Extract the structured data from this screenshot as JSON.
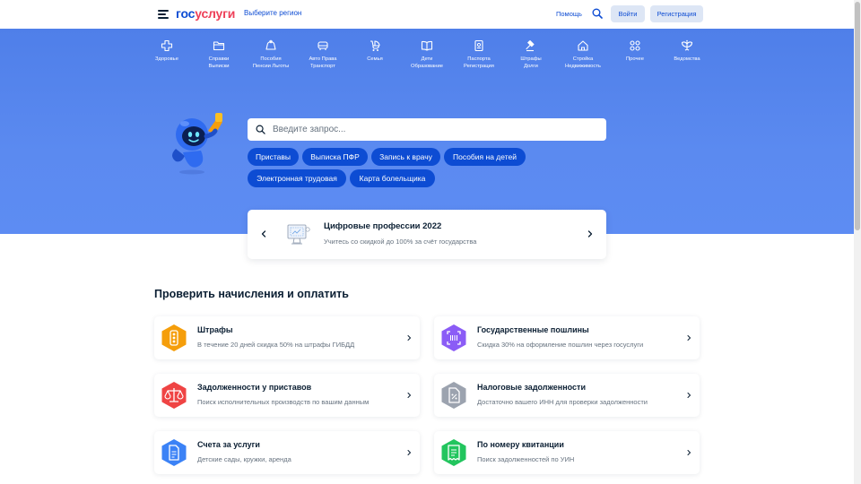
{
  "header": {
    "logo_part1": "гос",
    "logo_part2": "услуги",
    "region_link": "Выберите регион",
    "help_link": "Помощь",
    "login_button": "Войти",
    "register_button": "Регистрация"
  },
  "categories": [
    {
      "line1": "Здоровье",
      "line2": "",
      "icon": "health-cross-icon"
    },
    {
      "line1": "Справки",
      "line2": "Выписки",
      "icon": "folder-icon"
    },
    {
      "line1": "Пособия",
      "line2": "Пенсии Льготы",
      "icon": "piggy-bank-icon"
    },
    {
      "line1": "Авто Права",
      "line2": "Транспорт",
      "icon": "car-icon"
    },
    {
      "line1": "Семья",
      "line2": "",
      "icon": "stroller-icon"
    },
    {
      "line1": "Дети",
      "line2": "Образование",
      "icon": "book-icon"
    },
    {
      "line1": "Паспорта",
      "line2": "Регистрация",
      "icon": "passport-icon"
    },
    {
      "line1": "Штрафы",
      "line2": "Долги",
      "icon": "gavel-icon"
    },
    {
      "line1": "Стройка",
      "line2": "Недвижимость",
      "icon": "house-icon"
    },
    {
      "line1": "Прочее",
      "line2": "",
      "icon": "grid-icon"
    },
    {
      "line1": "Ведомства",
      "line2": "",
      "icon": "emblem-icon"
    }
  ],
  "search": {
    "placeholder": "Введите запрос..."
  },
  "chips": [
    "Приставы",
    "Выписка ПФР",
    "Запись к врачу",
    "Пособия на детей",
    "Электронная трудовая",
    "Карта болельщика"
  ],
  "promo": {
    "title": "Цифровые профессии 2022",
    "subtitle": "Учитесь со скидкой до 100% за счёт государства"
  },
  "section": {
    "title": "Проверить начисления и оплатить",
    "cards": [
      {
        "title": "Штрафы",
        "subtitle": "В течение 20 дней скидка 50% на штрафы ГИБДД",
        "color": "#f59e0b",
        "icon": "traffic-light-icon"
      },
      {
        "title": "Государственные пошлины",
        "subtitle": "Скидка 30% на оформление пошлин через госуслуги",
        "color": "#8b5cf6",
        "icon": "scan-icon"
      },
      {
        "title": "Задолженности у приставов",
        "subtitle": "Поиск исполнительных производств по вашим данным",
        "color": "#ef4444",
        "icon": "scales-icon"
      },
      {
        "title": "Налоговые задолженности",
        "subtitle": "Достаточно вашего ИНН для проверки задолженности",
        "color": "#9ca3af",
        "icon": "document-percent-icon"
      },
      {
        "title": "Счета за услуги",
        "subtitle": "Детские сады, кружки, аренда",
        "color": "#3b82f6",
        "icon": "bill-icon"
      },
      {
        "title": "По номеру квитанции",
        "subtitle": "Поиск задолженностей по УИН",
        "color": "#22c55e",
        "icon": "receipt-icon"
      }
    ]
  },
  "colors": {
    "brand_blue": "#0d4cd3",
    "brand_red": "#ee3f58",
    "hero_bg": "#5b8af0"
  }
}
